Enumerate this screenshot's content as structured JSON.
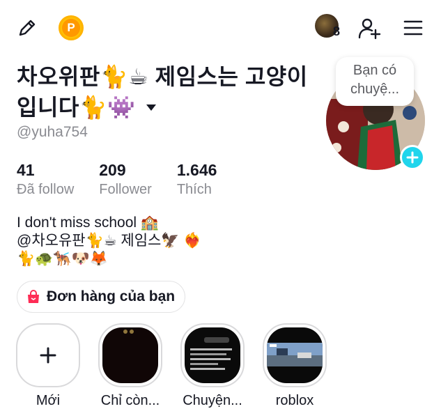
{
  "topbar": {
    "friends_count": "8",
    "points_letter": "P"
  },
  "profile": {
    "display_name_line1": "차오위판🐈☕ 제임스는 고양이",
    "display_name_line2": "입니다🐈👾",
    "username": "@yuha754",
    "avatar_bubble": "Bạn có chuyệ..."
  },
  "stats": [
    {
      "value": "41",
      "label": "Đã follow"
    },
    {
      "value": "209",
      "label": "Follower"
    },
    {
      "value": "1.646",
      "label": "Thích"
    }
  ],
  "bio": {
    "line1": "I don't miss school 🏫",
    "line2": "@차오유판🐈☕ 제임스🦅 ❤️‍🔥",
    "line3": "🐈🐢🐕‍🦺🐶🦊"
  },
  "orders_button": {
    "label": "Đơn hàng của bạn"
  },
  "highlights": [
    {
      "label": "Mới"
    },
    {
      "label": "Chỉ còn..."
    },
    {
      "label": "Chuyện..."
    },
    {
      "label": "roblox"
    }
  ],
  "colors": {
    "accent": "#20d5ec",
    "text": "#161823",
    "muted": "#8a8b91",
    "points": "#ffc107"
  }
}
